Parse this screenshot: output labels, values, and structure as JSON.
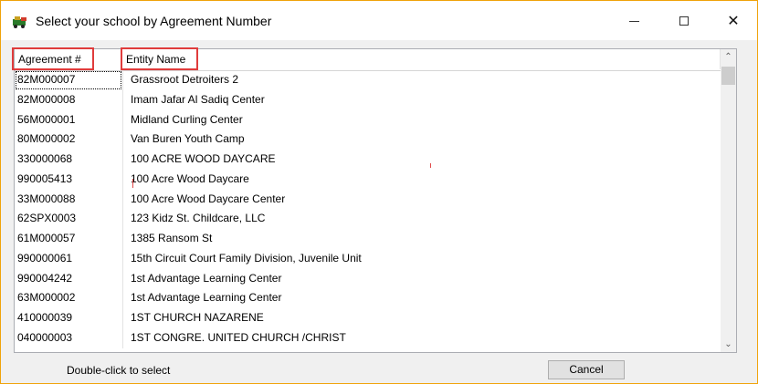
{
  "window": {
    "title": "Select your school by Agreement Number",
    "accent": "#f0a30a",
    "controls": {
      "minimize": "—",
      "maximize": "☐",
      "close": "✕"
    }
  },
  "list": {
    "columns": [
      "Agreement #",
      "Entity Name"
    ],
    "rows": [
      [
        "82M000007",
        "Grassroot Detroiters 2"
      ],
      [
        "82M000008",
        "Imam Jafar Al Sadiq Center"
      ],
      [
        "56M000001",
        "Midland Curling Center"
      ],
      [
        "80M000002",
        "Van Buren Youth Camp"
      ],
      [
        "330000068",
        "100 ACRE WOOD DAYCARE"
      ],
      [
        "990005413",
        "100 Acre Wood Daycare"
      ],
      [
        "33M000088",
        "100 Acre Wood Daycare Center"
      ],
      [
        "62SPX0003",
        "123 Kidz St. Childcare, LLC"
      ],
      [
        "61M000057",
        "1385 Ransom St"
      ],
      [
        "990000061",
        "15th Circuit Court Family Division, Juvenile Unit"
      ],
      [
        "990004242",
        "1st Advantage Learning Center"
      ],
      [
        "63M000002",
        "1st Advantage Learning Center"
      ],
      [
        "410000039",
        "1ST CHURCH NAZARENE"
      ],
      [
        "040000003",
        "1ST CONGRE.  UNITED CHURCH /CHRIST"
      ]
    ],
    "highlight_color": "#e03c3c"
  },
  "footer": {
    "hint": "Double-click to select",
    "cancel_label": "Cancel"
  },
  "icons": {
    "app": "school-bus-icon",
    "scroll_up": "chevron-up-icon",
    "scroll_down": "chevron-down-icon"
  }
}
